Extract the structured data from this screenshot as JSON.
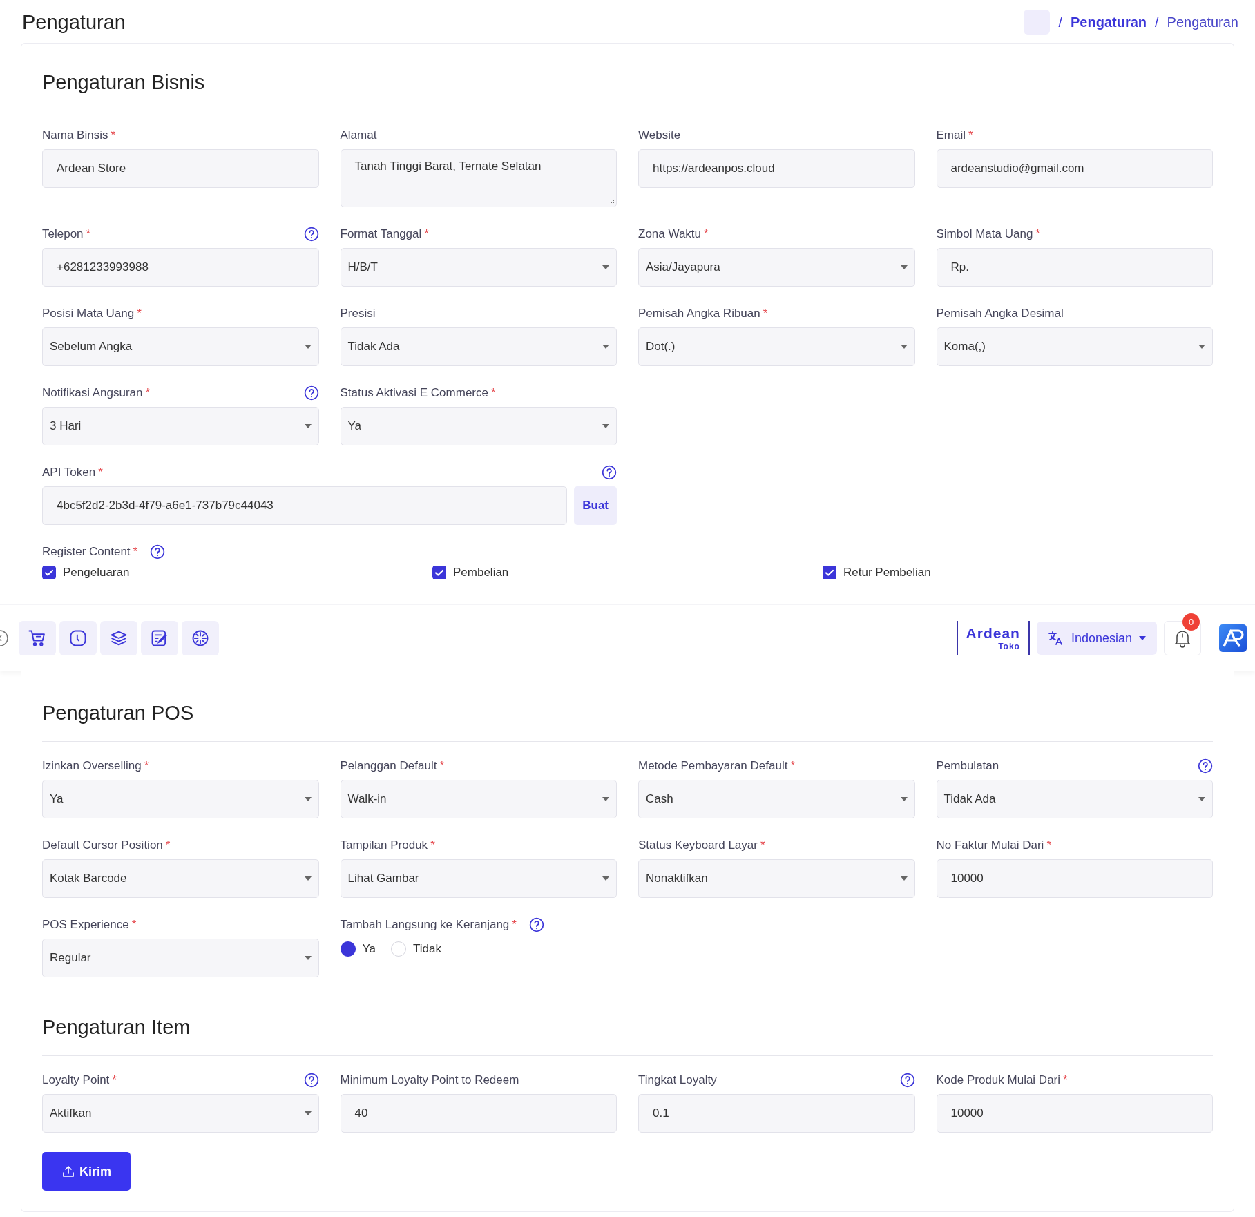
{
  "page": {
    "title": "Pengaturan",
    "separator": "/",
    "breadcrumb": [
      "Pengaturan",
      "Pengaturan"
    ]
  },
  "sections": [
    {
      "title": "Pengaturan Bisnis",
      "rows": [
        [
          {
            "kind": "text",
            "label": "Nama Binsis",
            "mark": "*",
            "value": "Ardean Store"
          },
          {
            "kind": "textarea",
            "label": "Alamat",
            "value": "Tanah Tinggi Barat, Ternate Selatan"
          },
          {
            "kind": "text",
            "label": "Website",
            "value": "https://ardeanpos.cloud"
          },
          {
            "kind": "text",
            "label": "Email",
            "mark": "*",
            "value": "ardeanstudio@gmail.com"
          }
        ],
        [
          {
            "kind": "text",
            "label": "Telepon",
            "mark": "*",
            "help": true,
            "value": "+6281233993988"
          },
          {
            "kind": "select",
            "label": "Format Tanggal",
            "mark": "*",
            "value": "H/B/T"
          },
          {
            "kind": "select",
            "label": "Zona Waktu",
            "mark": "*",
            "value": "Asia/Jayapura"
          },
          {
            "kind": "text",
            "label": "Simbol Mata Uang",
            "mark": "*",
            "value": "Rp."
          }
        ],
        [
          {
            "kind": "select",
            "label": "Posisi Mata Uang",
            "mark": "*",
            "value": "Sebelum Angka"
          },
          {
            "kind": "select",
            "label": "Presisi",
            "value": "Tidak Ada"
          },
          {
            "kind": "select",
            "label": "Pemisah Angka Ribuan",
            "mark": "*",
            "value": "Dot(.)"
          },
          {
            "kind": "select",
            "label": "Pemisah Angka Desimal",
            "value": "Koma(,)"
          }
        ],
        [
          {
            "kind": "select",
            "label": "Notifikasi Angsuran",
            "mark": "*",
            "help": true,
            "value": "3 Hari"
          },
          {
            "kind": "select",
            "label": "Status Aktivasi E Commerce",
            "mark": "*",
            "value": "Ya"
          }
        ],
        [
          {
            "kind": "token",
            "label": "API Token",
            "mark": "*",
            "help": true,
            "value": "4bc5f2d2-2b3d-4f79-a6e1-737b79c44043",
            "button": "Buat"
          }
        ],
        [
          {
            "kind": "checkboxes",
            "label": "Register Content",
            "mark": "*",
            "help": true,
            "options": [
              {
                "label": "Pengeluaran",
                "checked": true
              },
              {
                "label": "Pembelian",
                "checked": true
              },
              {
                "label": "Retur Pembelian",
                "checked": true
              }
            ]
          }
        ]
      ]
    },
    {
      "title": "Pengaturan POS",
      "rows": [
        [
          {
            "kind": "select",
            "label": "Izinkan Overselling",
            "mark": "*",
            "value": "Ya"
          },
          {
            "kind": "select",
            "label": "Pelanggan Default",
            "mark": "*",
            "value": "Walk-in"
          },
          {
            "kind": "select",
            "label": "Metode Pembayaran Default",
            "mark": "*",
            "value": "Cash"
          },
          {
            "kind": "select",
            "label": "Pembulatan",
            "help": true,
            "value": "Tidak Ada"
          }
        ],
        [
          {
            "kind": "select",
            "label": "Default Cursor Position",
            "mark": "*",
            "value": "Kotak Barcode"
          },
          {
            "kind": "select",
            "label": "Tampilan Produk",
            "mark": "*",
            "value": "Lihat Gambar"
          },
          {
            "kind": "select",
            "label": "Status Keyboard Layar",
            "mark": "*",
            "value": "Nonaktifkan"
          },
          {
            "kind": "text",
            "label": "No Faktur Mulai Dari",
            "mark": "*",
            "value": "10000"
          }
        ],
        [
          {
            "kind": "select",
            "label": "POS Experience",
            "mark": "*",
            "value": "Regular"
          },
          {
            "kind": "radio",
            "label": "Tambah Langsung ke Keranjang",
            "mark": "*",
            "help": true,
            "options": [
              {
                "label": "Ya",
                "selected": true
              },
              {
                "label": "Tidak",
                "selected": false
              }
            ]
          }
        ]
      ]
    },
    {
      "title": "Pengaturan Item",
      "rows": [
        [
          {
            "kind": "select",
            "label": "Loyalty Point",
            "mark": "*",
            "help": true,
            "value": "Aktifkan"
          },
          {
            "kind": "text",
            "label": "Minimum Loyalty Point to Redeem",
            "value": "40"
          },
          {
            "kind": "text",
            "label": "Tingkat Loyalty",
            "help": true,
            "value": "0.1"
          },
          {
            "kind": "text",
            "label": "Kode Produk Mulai Dari",
            "mark": "*",
            "value": "10000"
          }
        ]
      ]
    }
  ],
  "toolbar": {
    "brand": "Ardean",
    "brand_sub": "Toko",
    "language": "Indonesian",
    "notifications": "0"
  },
  "submit": "Kirim"
}
